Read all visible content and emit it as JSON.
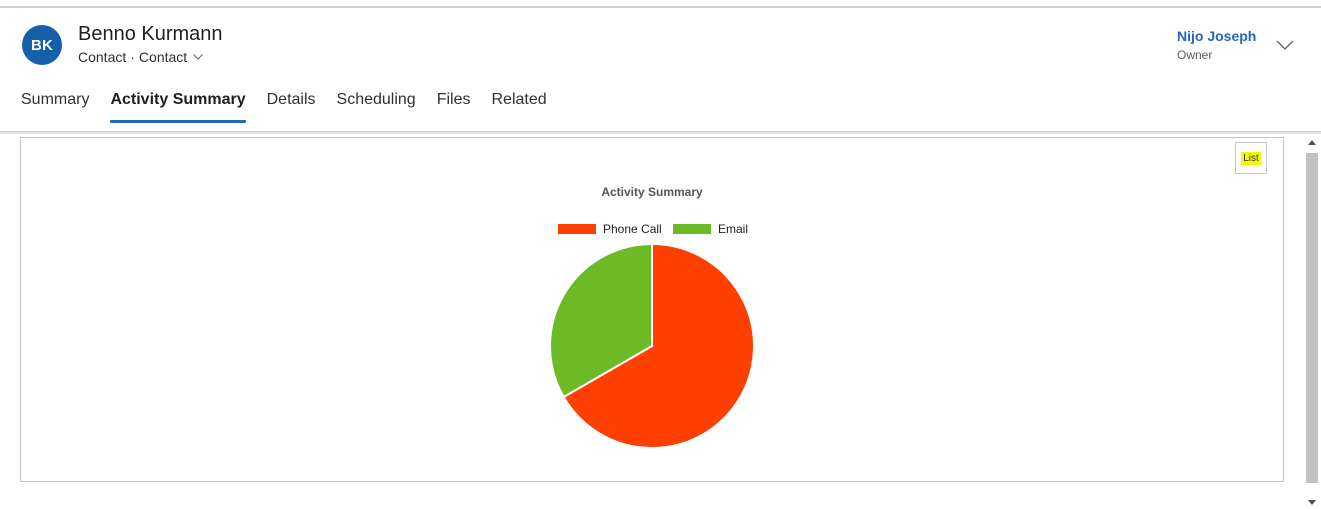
{
  "header": {
    "avatar_initials": "BK",
    "record_name": "Benno Kurmann",
    "entity": "Contact",
    "separator": "·",
    "form_name": "Contact",
    "owner_name": "Nijo Joseph",
    "owner_label": "Owner"
  },
  "tabs": [
    {
      "label": "Summary",
      "active": false
    },
    {
      "label": "Activity Summary",
      "active": true
    },
    {
      "label": "Details",
      "active": false
    },
    {
      "label": "Scheduling",
      "active": false
    },
    {
      "label": "Files",
      "active": false
    },
    {
      "label": "Related",
      "active": false
    }
  ],
  "chart_toolbar": {
    "list_label": "List"
  },
  "colors": {
    "accent": "#2266c5",
    "avatar": "#1560a8",
    "phone_call": "#ff4000",
    "email": "#6bba26",
    "highlight": "#f7f700"
  },
  "chart_data": {
    "type": "pie",
    "title": "Activity Summary",
    "legend_position": "top",
    "slices": [
      {
        "label": "Phone Call",
        "value": 2,
        "color": "#ff4000"
      },
      {
        "label": "Email",
        "value": 1,
        "color": "#6bba26"
      }
    ]
  }
}
